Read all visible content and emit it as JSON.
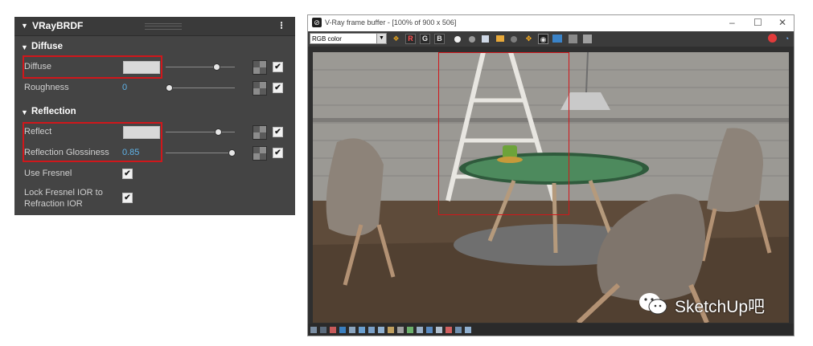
{
  "panel": {
    "title": "VRayBRDF",
    "menu_glyph": "⁝",
    "diffuse_section": {
      "label": "Diffuse"
    },
    "diffuse": {
      "label": "Diffuse",
      "slider_fraction": 0.9,
      "enabled": true
    },
    "roughness": {
      "label": "Roughness",
      "value": "0",
      "slider_fraction": 0.0,
      "enabled": true
    },
    "reflection_section": {
      "label": "Reflection"
    },
    "reflect": {
      "label": "Reflect",
      "slider_fraction": 0.9,
      "enabled": true
    },
    "reflection_glossiness": {
      "label": "Reflection Glossiness",
      "value": "0.85",
      "slider_fraction": 0.85,
      "enabled": true
    },
    "use_fresnel": {
      "label": "Use Fresnel",
      "checked": true
    },
    "lock_fresnel": {
      "label_line1": "Lock Fresnel IOR to",
      "label_line2": "Refraction IOR",
      "checked": true
    },
    "check_glyph": "✔",
    "expanded_glyph": "▼",
    "swatch_color": "#d9d9d9",
    "highlight_color": "#d0171b"
  },
  "vfb": {
    "title": "V-Ray frame buffer - [100% of 900 x 506]",
    "logo_glyph": "⊘",
    "minimize_glyph": "–",
    "maximize_glyph": "☐",
    "close_glyph": "✕",
    "channel_select": "RGB color",
    "channel_buttons": [
      "R",
      "G",
      "B"
    ],
    "watermark": "SketchUp吧",
    "region_color": "#d0171b"
  }
}
